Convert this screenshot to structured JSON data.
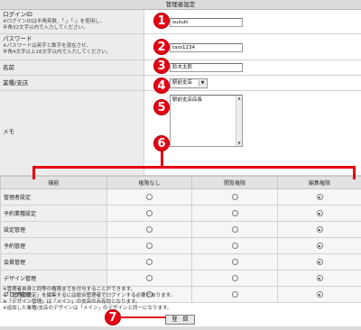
{
  "header": {
    "title": "管理者設定"
  },
  "form": {
    "login_id": {
      "label": "ログインID",
      "note_1": "※ログインIDは半角英数、「.」「-」を使用し、",
      "note_2": "半角32文字以内で入力してください。",
      "value": "suzuki"
    },
    "password": {
      "label": "パスワード",
      "note_1": "※パスワードは英字と数字を混在させ、",
      "note_2": "半角4文字以上16文字以内で入力してください。",
      "value": "taro1234"
    },
    "name": {
      "label": "名前",
      "value": "鈴木太郎"
    },
    "branch": {
      "label": "業種/支店",
      "selected": "駅前支店",
      "arrow": "▼"
    },
    "memo": {
      "label": "メモ",
      "value": "駅前支店店長",
      "scroll_up": "▲",
      "scroll_down": "▼"
    }
  },
  "permissions": {
    "headers": [
      "機能",
      "権限なし",
      "閲覧権限",
      "編集権限"
    ],
    "rows": [
      {
        "label": "管理者設定",
        "selected": 2
      },
      {
        "label": "予約業種設定",
        "selected": 2
      },
      {
        "label": "設定管理",
        "selected": 2
      },
      {
        "label": "予約管理",
        "selected": 2
      },
      {
        "label": "会員管理",
        "selected": 2
      },
      {
        "label": "デザイン管理",
        "selected": 2
      },
      {
        "label": "ブログ管理",
        "selected": 2
      }
    ]
  },
  "notes": [
    "※管理者自身と同等の権限までを付与することができます。",
    "※「管理者設定」を編集するには総合管理者でログインする必要があります。",
    "※「デザイン管理」は「メイン」の支店のみ有効となります。",
    "※追加した業種/支店のデザインは「メイン」のデザインと同一になります。"
  ],
  "submit_label": "登　録",
  "callouts": [
    "1",
    "2",
    "3",
    "4",
    "5",
    "6",
    "7"
  ],
  "colors": {
    "callout": "#e60012",
    "label_bg": "#ececec",
    "title_bg": "#dcdcdc"
  }
}
